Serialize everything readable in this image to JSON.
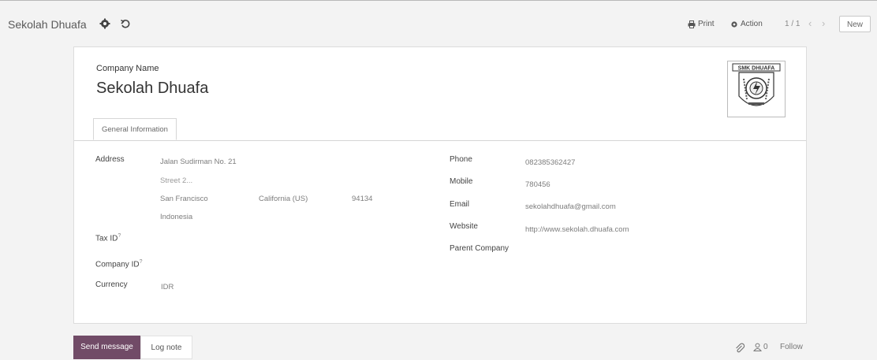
{
  "header": {
    "breadcrumb": "Sekolah Dhuafa",
    "print_label": "Print",
    "action_label": "Action",
    "pager_value": "1 / 1",
    "new_label": "New"
  },
  "form": {
    "company_label": "Company Name",
    "company_name": "Sekolah Dhuafa",
    "tab_label": "General Information",
    "address_label": "Address",
    "street": "Jalan Sudirman No. 21",
    "street2_placeholder": "Street 2...",
    "city": "San Francisco",
    "state": "California (US)",
    "zip": "94134",
    "country": "Indonesia",
    "tax_id_label": "Tax ID",
    "company_id_label": "Company ID",
    "help_mark": "?",
    "currency_label": "Currency",
    "currency": "IDR",
    "phone_label": "Phone",
    "phone": "082385362427",
    "mobile_label": "Mobile",
    "mobile": "780456",
    "email_label": "Email",
    "email": "sekolahdhuafa@gmail.com",
    "website_label": "Website",
    "website": "http://www.sekolah.dhuafa.com",
    "parent_company_label": "Parent Company",
    "logo_text": "SMK DHUAFA"
  },
  "chatter": {
    "send_message_label": "Send message",
    "log_note_label": "Log note",
    "follower_count": "0",
    "follow_label": "Follow"
  },
  "colors": {
    "accent": "#714b67",
    "background": "#f3f3f3"
  },
  "icons": {
    "settings": "gear-icon",
    "discard": "undo-icon",
    "print": "print-icon",
    "action": "gear-icon",
    "attachment": "paperclip-icon",
    "followers": "user-icon"
  }
}
